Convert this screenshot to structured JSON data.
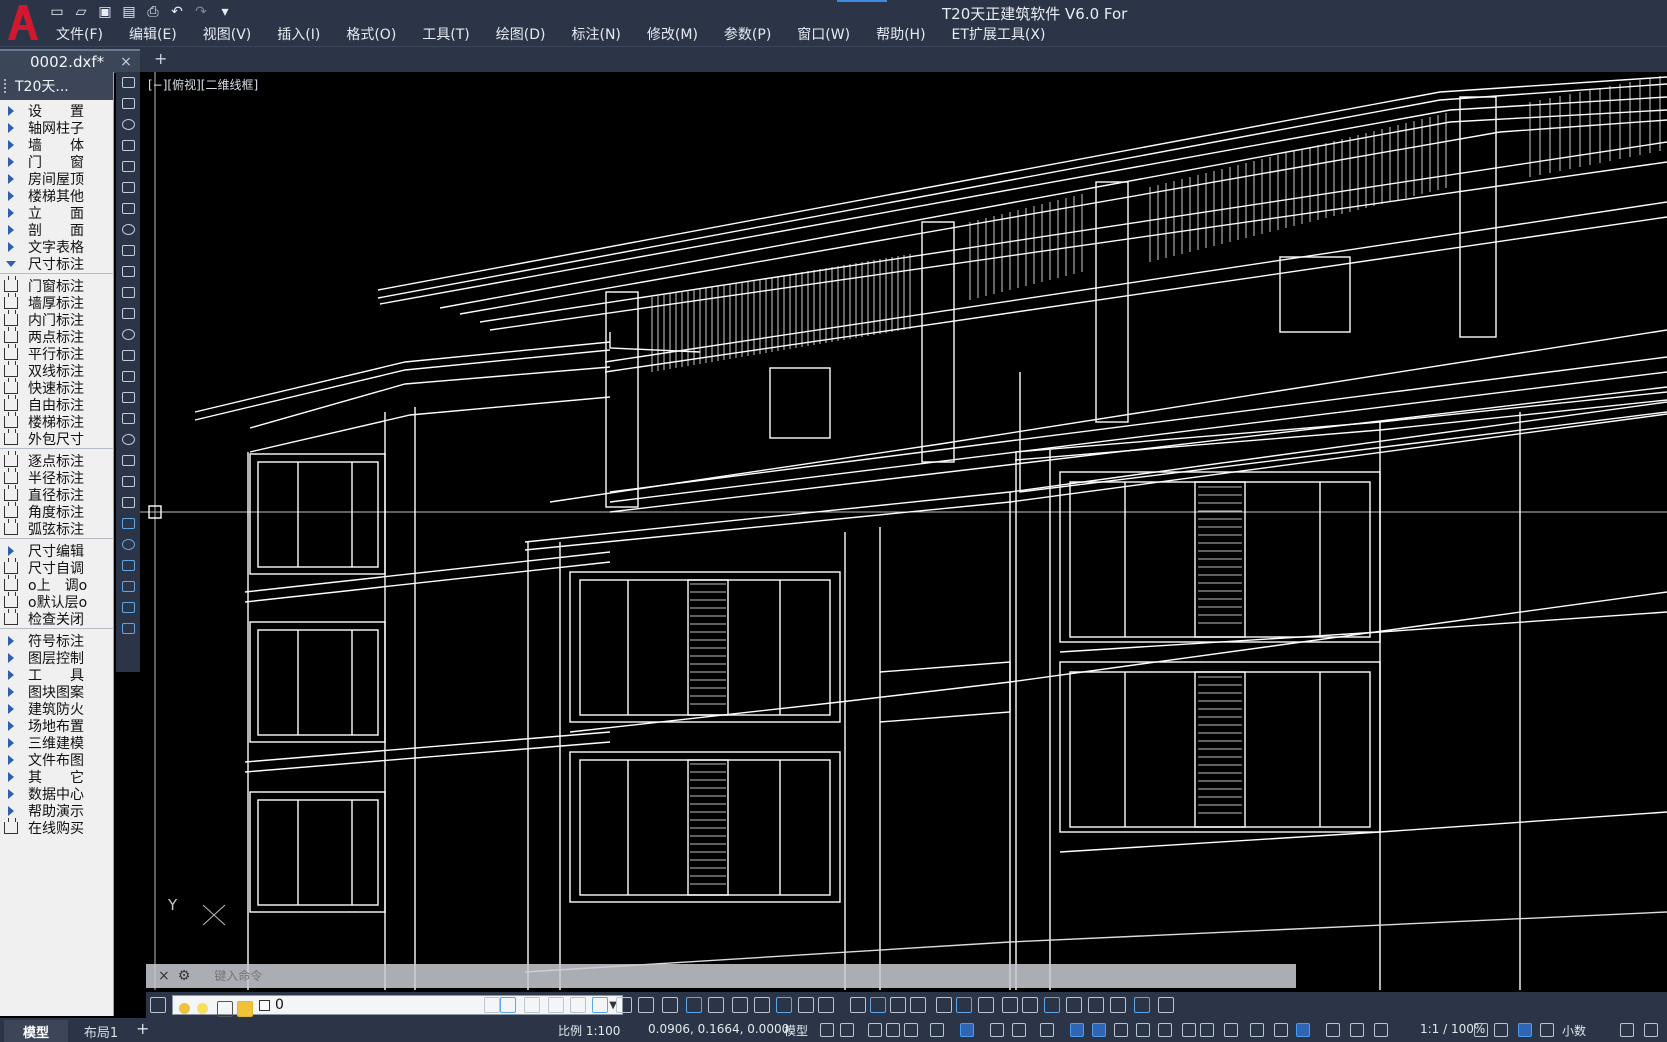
{
  "app": {
    "title": "T20天正建筑软件 V6.0 For",
    "accent_color": "#3f8ae0",
    "logo_color": "#c8102e",
    "logo_letter": "A"
  },
  "quick_access": [
    "new-icon",
    "open-icon",
    "save-icon",
    "saveas-icon",
    "print-icon",
    "undo-icon",
    "redo-icon",
    "customize-icon"
  ],
  "menu": [
    "文件(F)",
    "编辑(E)",
    "视图(V)",
    "插入(I)",
    "格式(O)",
    "工具(T)",
    "绘图(D)",
    "标注(N)",
    "修改(M)",
    "参数(P)",
    "窗口(W)",
    "帮助(H)",
    "ET扩展工具(X)"
  ],
  "tabs": {
    "document": "0002.dxf*",
    "close": "×",
    "add": "+"
  },
  "left_panel": {
    "title": "T20天...",
    "items": [
      {
        "label": "设　　置",
        "kind": "arrow"
      },
      {
        "label": "轴网柱子",
        "kind": "arrow"
      },
      {
        "label": "墙　　体",
        "kind": "arrow"
      },
      {
        "label": "门　　窗",
        "kind": "arrow"
      },
      {
        "label": "房间屋顶",
        "kind": "arrow"
      },
      {
        "label": "楼梯其他",
        "kind": "arrow"
      },
      {
        "label": "立　　面",
        "kind": "arrow"
      },
      {
        "label": "剖　　面",
        "kind": "arrow"
      },
      {
        "label": "文字表格",
        "kind": "arrow"
      },
      {
        "label": "尺寸标注",
        "kind": "open"
      },
      {
        "label": "门窗标注",
        "kind": "tool"
      },
      {
        "label": "墙厚标注",
        "kind": "tool"
      },
      {
        "label": "内门标注",
        "kind": "tool"
      },
      {
        "label": "两点标注",
        "kind": "tool"
      },
      {
        "label": "平行标注",
        "kind": "tool"
      },
      {
        "label": "双线标注",
        "kind": "tool"
      },
      {
        "label": "快速标注",
        "kind": "tool"
      },
      {
        "label": "自由标注",
        "kind": "tool"
      },
      {
        "label": "楼梯标注",
        "kind": "tool"
      },
      {
        "label": "外包尺寸",
        "kind": "tool"
      },
      {
        "label": "逐点标注",
        "kind": "tool"
      },
      {
        "label": "半径标注",
        "kind": "tool"
      },
      {
        "label": "直径标注",
        "kind": "tool"
      },
      {
        "label": "角度标注",
        "kind": "tool"
      },
      {
        "label": "弧弦标注",
        "kind": "tool"
      },
      {
        "label": "尺寸编辑",
        "kind": "arrow"
      },
      {
        "label": "尺寸自调",
        "kind": "tool"
      },
      {
        "label": "o上　调o",
        "kind": "tool"
      },
      {
        "label": "o默认层o",
        "kind": "tool"
      },
      {
        "label": "检查关闭",
        "kind": "tool"
      },
      {
        "label": "符号标注",
        "kind": "arrow"
      },
      {
        "label": "图层控制",
        "kind": "arrow"
      },
      {
        "label": "工　　具",
        "kind": "arrow"
      },
      {
        "label": "图块图案",
        "kind": "arrow"
      },
      {
        "label": "建筑防火",
        "kind": "arrow"
      },
      {
        "label": "场地布置",
        "kind": "arrow"
      },
      {
        "label": "三维建模",
        "kind": "arrow"
      },
      {
        "label": "文件布图",
        "kind": "arrow"
      },
      {
        "label": "其　　它",
        "kind": "arrow"
      },
      {
        "label": "数据中心",
        "kind": "arrow"
      },
      {
        "label": "帮助演示",
        "kind": "arrow"
      },
      {
        "label": "在线购买",
        "kind": "tool"
      }
    ]
  },
  "viewport": {
    "label": "[−][俯视][二维线框]",
    "ucs_y": "Y"
  },
  "command_line": {
    "placeholder": "键入命令",
    "close": "×",
    "wrench": "🔧"
  },
  "layer": {
    "current": "0"
  },
  "status": {
    "model_tab": "模型",
    "layout_tab": "布局1",
    "add": "+",
    "scale": "比例 1:100",
    "coords": "0.0906, 0.1664, 0.0000",
    "mode": "模型",
    "annotation_scale": "1:1 / 100%",
    "units": "小数"
  }
}
